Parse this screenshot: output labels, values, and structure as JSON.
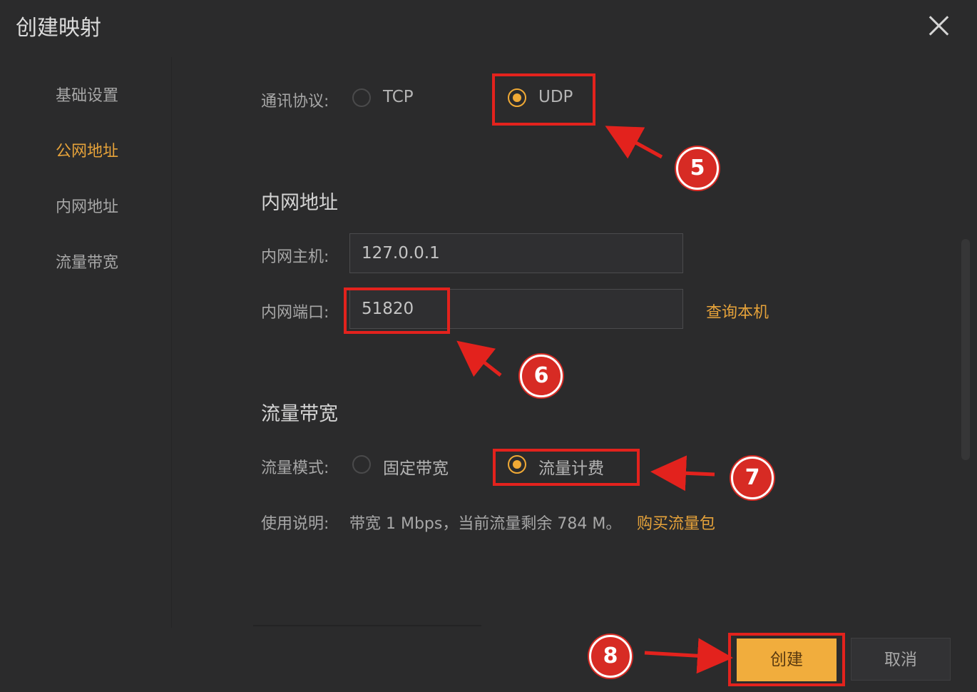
{
  "dialog": {
    "title": "创建映射"
  },
  "sidebar": {
    "items": [
      {
        "label": "基础设置"
      },
      {
        "label": "公网地址"
      },
      {
        "label": "内网地址"
      },
      {
        "label": "流量带宽"
      }
    ]
  },
  "protocol": {
    "label": "通讯协议:",
    "options": [
      {
        "label": "TCP",
        "selected": false
      },
      {
        "label": "UDP",
        "selected": true
      }
    ]
  },
  "intranet": {
    "section_title": "内网地址",
    "host_label": "内网主机:",
    "host_value": "127.0.0.1",
    "port_label": "内网端口:",
    "port_value": "51820",
    "query_link": "查询本机"
  },
  "bandwidth": {
    "section_title": "流量带宽",
    "mode_label": "流量模式:",
    "options": [
      {
        "label": "固定带宽",
        "selected": false
      },
      {
        "label": "流量计费",
        "selected": true
      }
    ],
    "usage_label": "使用说明:",
    "usage_text": "带宽 1 Mbps，当前流量剩余 784 M。",
    "buy_link": "购买流量包"
  },
  "footer": {
    "create_label": "创建",
    "cancel_label": "取消"
  },
  "annotations": [
    {
      "number": "5"
    },
    {
      "number": "6"
    },
    {
      "number": "7"
    },
    {
      "number": "8"
    }
  ],
  "colors": {
    "accent": "#f0a935",
    "highlight": "#e3221d",
    "background": "#2b2b2c"
  }
}
